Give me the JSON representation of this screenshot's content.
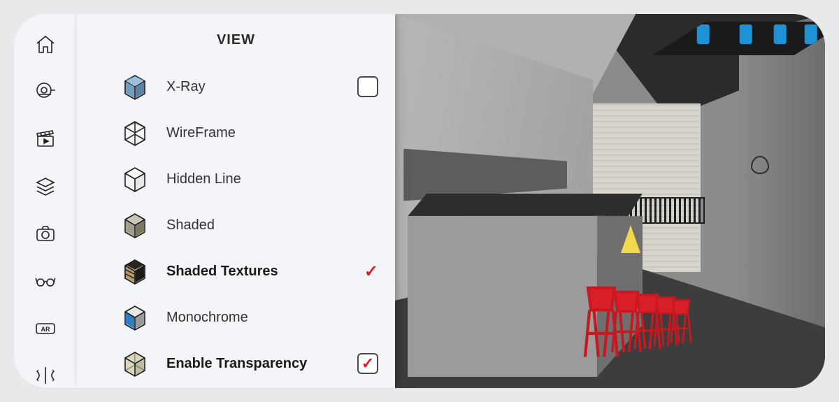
{
  "panel": {
    "title": "VIEW",
    "items": [
      {
        "label": "X-Ray",
        "style": "xray",
        "has_checkbox": true,
        "checked": false,
        "selected": false
      },
      {
        "label": "WireFrame",
        "style": "wireframe",
        "has_checkbox": false,
        "checked": false,
        "selected": false
      },
      {
        "label": "Hidden Line",
        "style": "hidden",
        "has_checkbox": false,
        "checked": false,
        "selected": false
      },
      {
        "label": "Shaded",
        "style": "shaded",
        "has_checkbox": false,
        "checked": false,
        "selected": false
      },
      {
        "label": "Shaded Textures",
        "style": "shadedtex",
        "has_checkbox": false,
        "checked": true,
        "selected": true
      },
      {
        "label": "Monochrome",
        "style": "mono",
        "has_checkbox": false,
        "checked": false,
        "selected": false
      },
      {
        "label": "Enable Transparency",
        "style": "transparency",
        "has_checkbox": true,
        "checked": true,
        "selected": false,
        "bold": true
      }
    ]
  },
  "sidebar": {
    "items": [
      {
        "name": "home"
      },
      {
        "name": "tape-measure"
      },
      {
        "name": "scenes"
      },
      {
        "name": "layers"
      },
      {
        "name": "camera"
      },
      {
        "name": "styles"
      },
      {
        "name": "ar"
      },
      {
        "name": "mirror"
      }
    ]
  }
}
